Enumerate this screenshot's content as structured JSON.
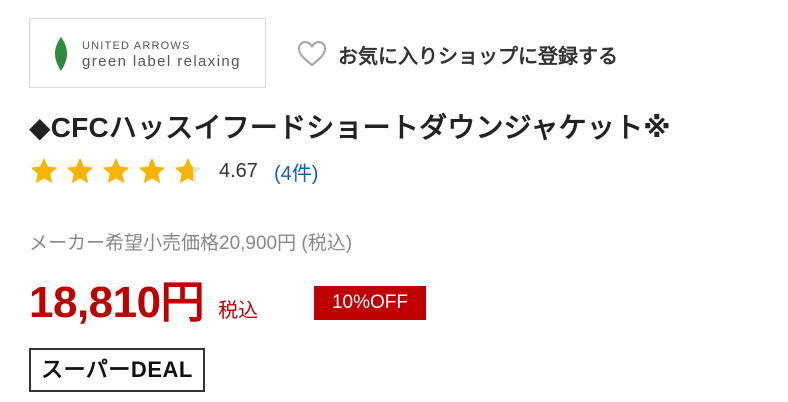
{
  "shop": {
    "logo_line1": "UNITED ARROWS",
    "logo_line2": "green label relaxing",
    "logo_color": "#2f8a3b",
    "favorite_label": "お気に入りショップに登録する",
    "favorite_icon": "heart-outline-icon"
  },
  "product": {
    "title": "◆CFCハッスイフードショートダウンジャケット※"
  },
  "rating": {
    "value": "4.67",
    "stars_filled": 4.67,
    "stars_max": 5,
    "star_color": "#f7b500",
    "review_count": "(4件)"
  },
  "pricing": {
    "msrp": "メーカー希望小売価格20,900円 (税込)",
    "price": "18,810円",
    "tax_label": "税込",
    "discount_badge": "10%OFF",
    "accent_color": "#bf0000"
  },
  "badges": {
    "super_deal": "スーパーDEAL"
  }
}
